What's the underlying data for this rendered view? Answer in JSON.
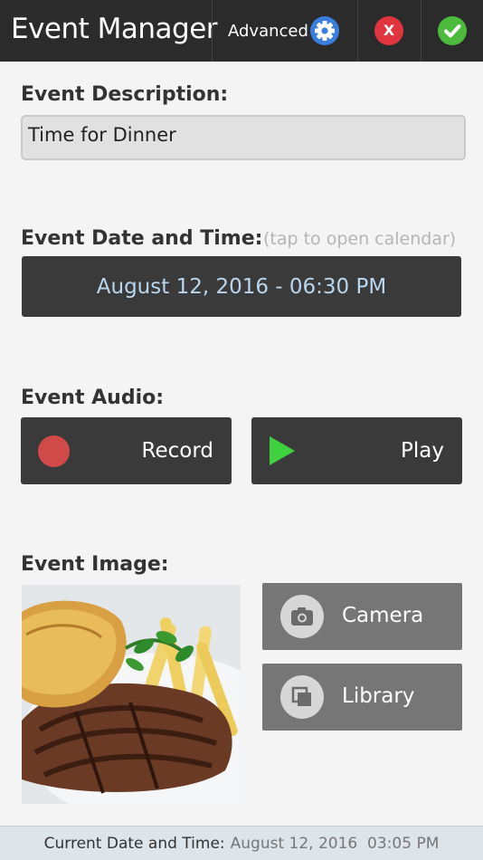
{
  "header": {
    "title": "Event Manager",
    "advanced_label": "Advanced",
    "close_symbol": "X"
  },
  "description": {
    "label": "Event Description:",
    "value": "Time for Dinner"
  },
  "date_time": {
    "label": "Event Date and Time:",
    "hint": "(tap to open calendar)",
    "value": "August 12, 2016 - 06:30 PM"
  },
  "audio": {
    "label": "Event Audio:",
    "record_label": "Record",
    "play_label": "Play"
  },
  "image": {
    "label": "Event Image:",
    "camera_label": "Camera",
    "library_label": "Library"
  },
  "footer": {
    "label": "Current Date and Time:",
    "value": "August 12, 2016  03:05 PM"
  },
  "colors": {
    "topbar": "#2b2b2b",
    "gear": "#3b7ddd",
    "close": "#e0353f",
    "confirm": "#4cba3c",
    "date_text": "#b9d6ee",
    "record": "#d14a4a",
    "play": "#3fd13f"
  }
}
